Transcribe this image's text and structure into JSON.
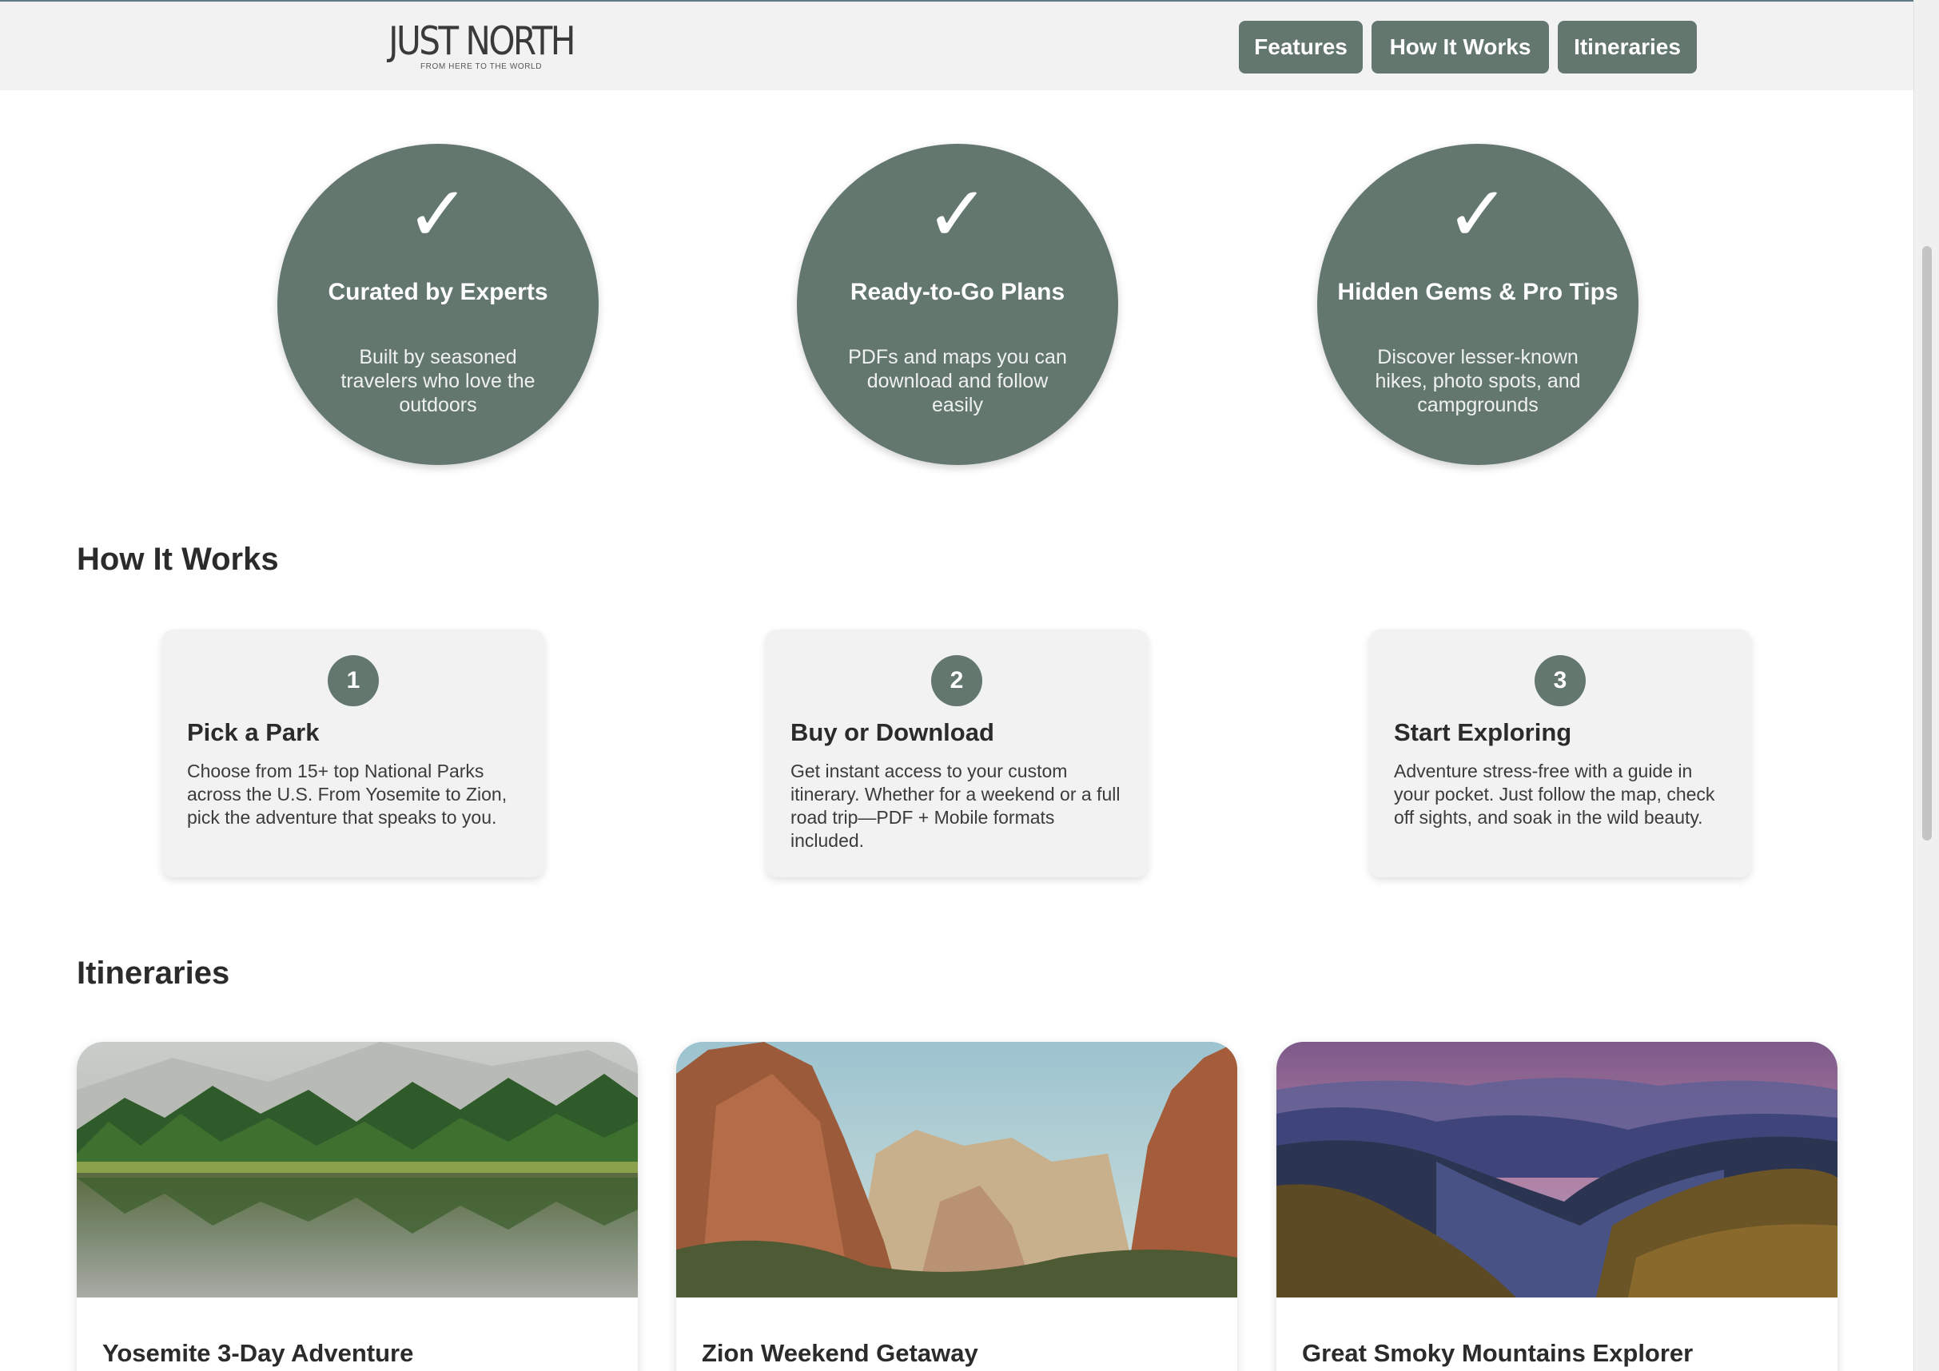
{
  "header": {
    "logo_main": "JUST NORTH",
    "logo_tagline": "FROM HERE TO THE WORLD",
    "nav": [
      "Features",
      "How It Works",
      "Itineraries"
    ]
  },
  "features": [
    {
      "icon": "checkmark",
      "title": "Curated by Experts",
      "description": "Built by seasoned travelers who love the outdoors"
    },
    {
      "icon": "checkmark",
      "title": "Ready-to-Go Plans",
      "description": "PDFs and maps you can download and follow easily"
    },
    {
      "icon": "checkmark",
      "title": "Hidden Gems & Pro Tips",
      "description": "Discover lesser-known hikes, photo spots, and campgrounds"
    }
  ],
  "how_it_works": {
    "heading": "How It Works",
    "steps": [
      {
        "number": "1",
        "title": "Pick a Park",
        "description": "Choose from 15+ top National Parks across the U.S. From Yosemite to Zion, pick the adventure that speaks to you."
      },
      {
        "number": "2",
        "title": "Buy or Download",
        "description": "Get instant access to your custom itinerary. Whether for a weekend or a full road trip—PDF + Mobile formats included."
      },
      {
        "number": "3",
        "title": "Start Exploring",
        "description": "Adventure stress-free with a guide in your pocket. Just follow the map, check off sights, and soak in the wild beauty."
      }
    ]
  },
  "itineraries": {
    "heading": "Itineraries",
    "items": [
      {
        "title": "Yosemite 3-Day Adventure"
      },
      {
        "title": "Zion Weekend Getaway"
      },
      {
        "title": "Great Smoky Mountains Explorer"
      }
    ]
  },
  "colors": {
    "accent": "#64776f",
    "header_bg": "#f2f2f2",
    "card_bg": "#f2f2f2"
  }
}
